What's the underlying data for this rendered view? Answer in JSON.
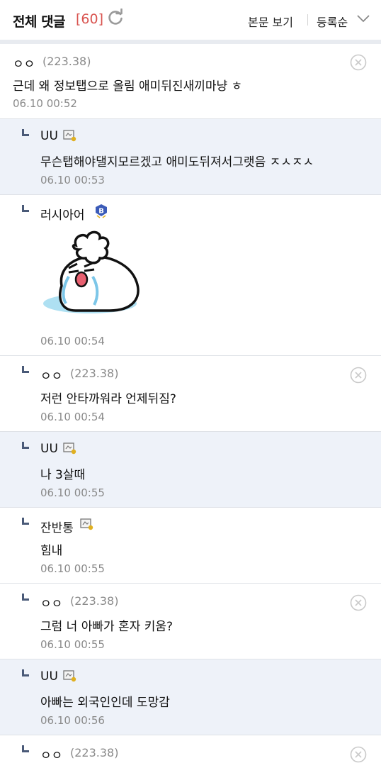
{
  "header": {
    "title": "전체 댓글",
    "count": "[60]",
    "view_body_label": "본문 보기",
    "sort_label": "등록순",
    "refresh_icon": "refresh-icon",
    "sort_icon": "chevron-down-icon",
    "accent_color": "#d9534f"
  },
  "comments": [
    {
      "author": "ㅇㅇ",
      "ip": "(223.38)",
      "text": "근데 왜 정보탭으로 올림 애미뒤진새끼마냥 ㅎ",
      "time": "06.10 00:52",
      "reply": false
    },
    {
      "author": "UU",
      "text": "무슨탭해야댈지모르겠고 애미도뒤져서그랫음 ㅈㅅㅈㅅ",
      "time": "06.10 00:53",
      "reply": true
    },
    {
      "author": "러시아어",
      "badge": "B",
      "image": "crying-emoticon",
      "time": "06.10 00:54",
      "reply": true
    },
    {
      "author": "ㅇㅇ",
      "ip": "(223.38)",
      "text": "저런 안타까워라 언제뒤짐?",
      "time": "06.10 00:54",
      "reply": true
    },
    {
      "author": "UU",
      "text": "나 3살때",
      "time": "06.10 00:55",
      "reply": true
    },
    {
      "author": "잔반통",
      "text": "힘내",
      "time": "06.10 00:55",
      "reply": true
    },
    {
      "author": "ㅇㅇ",
      "ip": "(223.38)",
      "text": "그럼 너 아빠가 혼자 키움?",
      "time": "06.10 00:55",
      "reply": true
    },
    {
      "author": "UU",
      "text": "아빠는 외국인인데 도망감",
      "time": "06.10 00:56",
      "reply": true
    },
    {
      "author": "ㅇㅇ",
      "ip": "(223.38)",
      "reply": true
    }
  ]
}
